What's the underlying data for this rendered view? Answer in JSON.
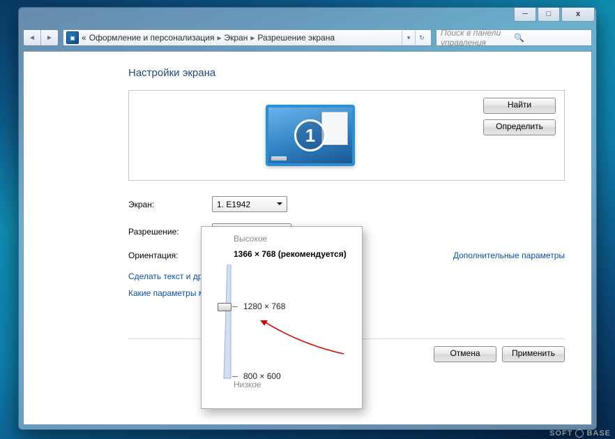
{
  "breadcrumbs": {
    "prefix": "«",
    "part1": "Оформление и персонализация",
    "part2": "Экран",
    "part3": "Разрешение экрана"
  },
  "search": {
    "placeholder": "Поиск в панели управления"
  },
  "heading": "Настройки экрана",
  "side_buttons": {
    "find": "Найти",
    "identify": "Определить"
  },
  "monitor": {
    "number": "1"
  },
  "form": {
    "screen_label": "Экран:",
    "screen_value": "1. E1942",
    "resolution_label": "Разрешение:",
    "resolution_value": "1280 × 768",
    "orientation_label": "Ориентация:"
  },
  "extra_params_link": "Дополнительные параметры",
  "links": {
    "text_link_1": "Сделать текст и другие",
    "text_link_2": "Какие параметры мон"
  },
  "bottom_buttons": {
    "cancel": "Отмена",
    "apply": "Применить"
  },
  "popup": {
    "high_label": "Высокое",
    "recommended": "1366 × 768 (рекомендуется)",
    "current": "1280 × 768",
    "min": "800 × 600",
    "low_label": "Низкое"
  },
  "watermark": {
    "a": "SOFT",
    "b": "BASE"
  },
  "chart_data": {
    "type": "slider",
    "orientation": "vertical",
    "high_label": "Высокое",
    "low_label": "Низкое",
    "options": [
      "1366 × 768 (рекомендуется)",
      "1280 × 768",
      "800 × 600"
    ],
    "selected": "1280 × 768"
  }
}
